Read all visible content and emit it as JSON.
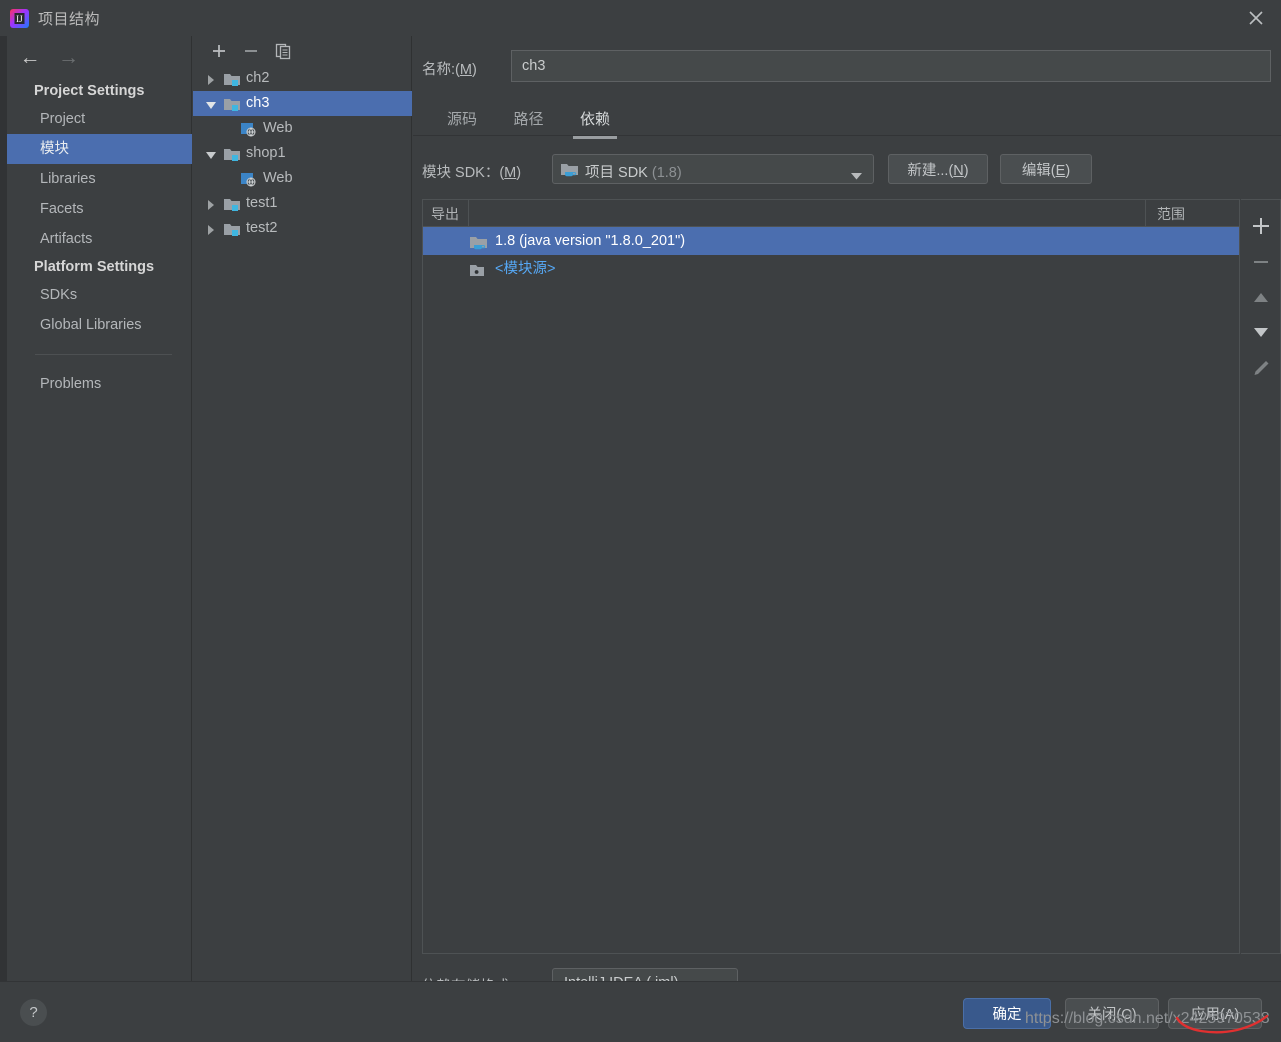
{
  "window": {
    "title": "项目结构",
    "close_icon": "close-icon",
    "app_icon": "intellij-idea-logo"
  },
  "sidebar": {
    "nav": {
      "back_icon": "arrow-left-icon",
      "forward_icon": "arrow-right-icon"
    },
    "sections": [
      {
        "heading": "Project Settings",
        "items": [
          {
            "label": "Project",
            "selected": false
          },
          {
            "label": "模块",
            "selected": true
          },
          {
            "label": "Libraries",
            "selected": false
          },
          {
            "label": "Facets",
            "selected": false
          },
          {
            "label": "Artifacts",
            "selected": false
          }
        ]
      },
      {
        "heading": "Platform Settings",
        "items": [
          {
            "label": "SDKs",
            "selected": false
          },
          {
            "label": "Global Libraries",
            "selected": false
          }
        ]
      }
    ],
    "problems_label": "Problems"
  },
  "tree": {
    "toolbar": [
      {
        "icon": "plus-icon",
        "name": "add-module-button"
      },
      {
        "icon": "minus-icon",
        "name": "remove-module-button"
      },
      {
        "icon": "copy-icon",
        "name": "copy-module-button"
      }
    ],
    "nodes": [
      {
        "label": "ch2",
        "indent": 0,
        "twisty": "collapsed",
        "icon": "module-folder-icon",
        "selected": false
      },
      {
        "label": "ch3",
        "indent": 0,
        "twisty": "expanded",
        "icon": "module-folder-icon",
        "selected": true
      },
      {
        "label": "Web",
        "indent": 1,
        "twisty": "none",
        "icon": "web-facet-icon",
        "selected": false
      },
      {
        "label": "shop1",
        "indent": 0,
        "twisty": "expanded",
        "icon": "module-folder-icon",
        "selected": false
      },
      {
        "label": "Web",
        "indent": 1,
        "twisty": "none",
        "icon": "web-facet-icon",
        "selected": false
      },
      {
        "label": "test1",
        "indent": 0,
        "twisty": "collapsed",
        "icon": "module-folder-icon",
        "selected": false
      },
      {
        "label": "test2",
        "indent": 0,
        "twisty": "collapsed",
        "icon": "module-folder-icon",
        "selected": false
      }
    ]
  },
  "main": {
    "name_label": "名称:(M)",
    "name_mnemonic": "M",
    "name_value": "ch3",
    "tabs": [
      {
        "label": "源码",
        "active": false
      },
      {
        "label": "路径",
        "active": false
      },
      {
        "label": "依赖",
        "active": true
      }
    ],
    "sdk_label": "模块 SDK：(M)",
    "sdk_value": "项目 SDK",
    "sdk_version": "(1.8)",
    "sdk_icon": "jdk-folder-icon",
    "sdk_dropdown_icon": "chevron-down-icon",
    "new_button": "新建...(N)",
    "edit_button": "编辑(E)",
    "table": {
      "columns": [
        "导出",
        "范围"
      ],
      "rows": [
        {
          "icon": "jdk-folder-icon",
          "text": "1.8 (java version \"1.8.0_201\")",
          "selected": true,
          "link": false,
          "scope": ""
        },
        {
          "icon": "module-source-icon",
          "text": "<模块源>",
          "selected": false,
          "link": true,
          "scope": ""
        }
      ]
    },
    "side_tools": [
      {
        "icon": "plus-icon",
        "name": "add-dependency-button",
        "enabled": true
      },
      {
        "icon": "minus-icon",
        "name": "remove-dependency-button",
        "enabled": false
      },
      {
        "icon": "arrow-up-icon",
        "name": "move-up-button",
        "enabled": false
      },
      {
        "icon": "arrow-down-icon",
        "name": "move-down-button",
        "enabled": true
      },
      {
        "icon": "pencil-icon",
        "name": "edit-dependency-button",
        "enabled": false
      }
    ],
    "store_label": "依赖存储格式：",
    "store_value": "IntelliJ IDEA (.iml)",
    "store_dropdown_icon": "chevron-down-icon"
  },
  "footer": {
    "help_icon": "?",
    "ok_button": "确定",
    "close_button": "关闭(C)",
    "apply_button": "应用(A)",
    "watermark": "https://blog.csdn.net/x2425970538"
  },
  "colors": {
    "background": "#3c3f41",
    "selection": "#4b6eaf",
    "primary_button": "#39598c",
    "link": "#56a8f5",
    "accent_badge": "#40b6e0",
    "watermark_scribble": "#e03030"
  }
}
